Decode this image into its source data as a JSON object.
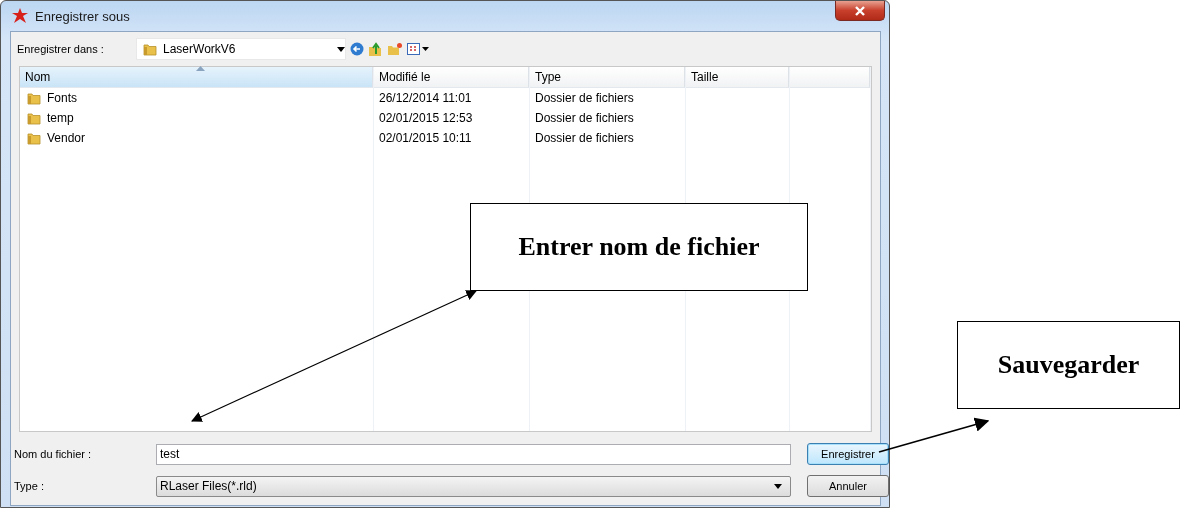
{
  "window": {
    "title": "Enregistrer sous"
  },
  "save_in": {
    "label": "Enregistrer dans :",
    "value": "LaserWorkV6"
  },
  "columns": [
    {
      "label": "Nom",
      "sorted": true
    },
    {
      "label": "Modifié le",
      "sorted": false
    },
    {
      "label": "Type",
      "sorted": false
    },
    {
      "label": "Taille",
      "sorted": false
    }
  ],
  "rows": [
    {
      "name": "Fonts",
      "modified": "26/12/2014 11:01",
      "type": "Dossier de fichiers"
    },
    {
      "name": "temp",
      "modified": "02/01/2015 12:53",
      "type": "Dossier de fichiers"
    },
    {
      "name": "Vendor",
      "modified": "02/01/2015 10:11",
      "type": "Dossier de fichiers"
    }
  ],
  "file_name": {
    "label": "Nom du fichier :",
    "value": "test"
  },
  "file_type": {
    "label": "Type :",
    "value": "RLaser Files(*.rld)"
  },
  "buttons": [
    {
      "label": "Enregistrer",
      "kind": "default"
    },
    {
      "label": "Annuler",
      "kind": "normal"
    }
  ],
  "annotations": [
    {
      "text": "Entrer nom de fichier"
    },
    {
      "text": "Sauvegarder"
    }
  ]
}
